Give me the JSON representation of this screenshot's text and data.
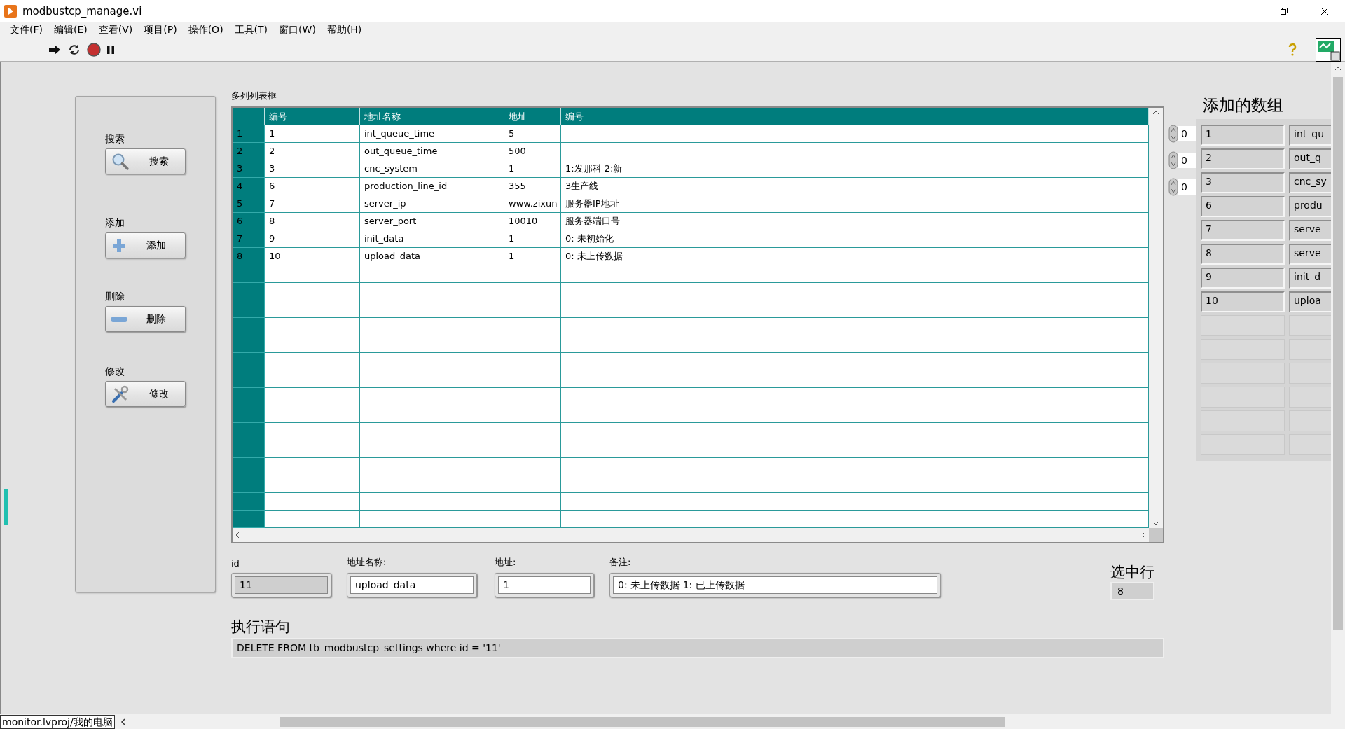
{
  "window": {
    "title": "modbustcp_manage.vi"
  },
  "menu": [
    "文件(F)",
    "编辑(E)",
    "查看(V)",
    "项目(P)",
    "操作(O)",
    "工具(T)",
    "窗口(W)",
    "帮助(H)"
  ],
  "side_panel": {
    "groups": [
      {
        "label": "搜索",
        "button": "搜索",
        "kind": "search"
      },
      {
        "label": "添加",
        "button": "添加",
        "kind": "add"
      },
      {
        "label": "删除",
        "button": "删除",
        "kind": "delete"
      },
      {
        "label": "修改",
        "button": "修改",
        "kind": "edit"
      }
    ]
  },
  "table": {
    "label": "多列列表框",
    "columns": [
      "编号",
      "地址名称",
      "地址",
      "编号"
    ],
    "rows": [
      {
        "index": "1",
        "cells": [
          "1",
          "int_queue_time",
          "5"
        ]
      },
      {
        "index": "2",
        "cells": [
          "2",
          "out_queue_time",
          "500"
        ]
      },
      {
        "index": "3",
        "cells": [
          "3",
          "cnc_system",
          "1",
          "1:发那科 2:新"
        ]
      },
      {
        "index": "4",
        "cells": [
          "6",
          "production_line_id",
          "355",
          "3生产线"
        ]
      },
      {
        "index": "5",
        "cells": [
          "7",
          "server_ip",
          "www.zixun",
          "服务器IP地址"
        ]
      },
      {
        "index": "6",
        "cells": [
          "8",
          "server_port",
          "10010",
          "服务器端口号"
        ]
      },
      {
        "index": "7",
        "cells": [
          "9",
          "init_data",
          "1",
          "0: 未初始化"
        ]
      },
      {
        "index": "8",
        "cells": [
          "10",
          "upload_data",
          "1",
          "0: 未上传数据"
        ]
      }
    ]
  },
  "array": {
    "title": "添加的数组",
    "indices": [
      "0",
      "0",
      "0"
    ],
    "rows": [
      [
        "1",
        "int_qu"
      ],
      [
        "2",
        "out_q"
      ],
      [
        "3",
        "cnc_sy"
      ],
      [
        "6",
        "produ"
      ],
      [
        "7",
        "serve"
      ],
      [
        "8",
        "serve"
      ],
      [
        "9",
        "init_d"
      ],
      [
        "10",
        "uploa"
      ]
    ]
  },
  "form": {
    "fields": [
      {
        "label": "id",
        "value": "11",
        "kind": "indicator"
      },
      {
        "label": "地址名称:",
        "value": "upload_data",
        "kind": "control"
      },
      {
        "label": "地址:",
        "value": "1",
        "kind": "control"
      },
      {
        "label": "备注:",
        "value": "0: 未上传数据  1: 已上传数据",
        "kind": "control"
      }
    ]
  },
  "selected_row": {
    "label": "选中行",
    "value": "8"
  },
  "statement": {
    "label": "执行语句",
    "value": "DELETE FROM tb_modbustcp_settings where id = '11'"
  },
  "status_bar": {
    "path": "monitor.lvproj/我的电脑"
  }
}
